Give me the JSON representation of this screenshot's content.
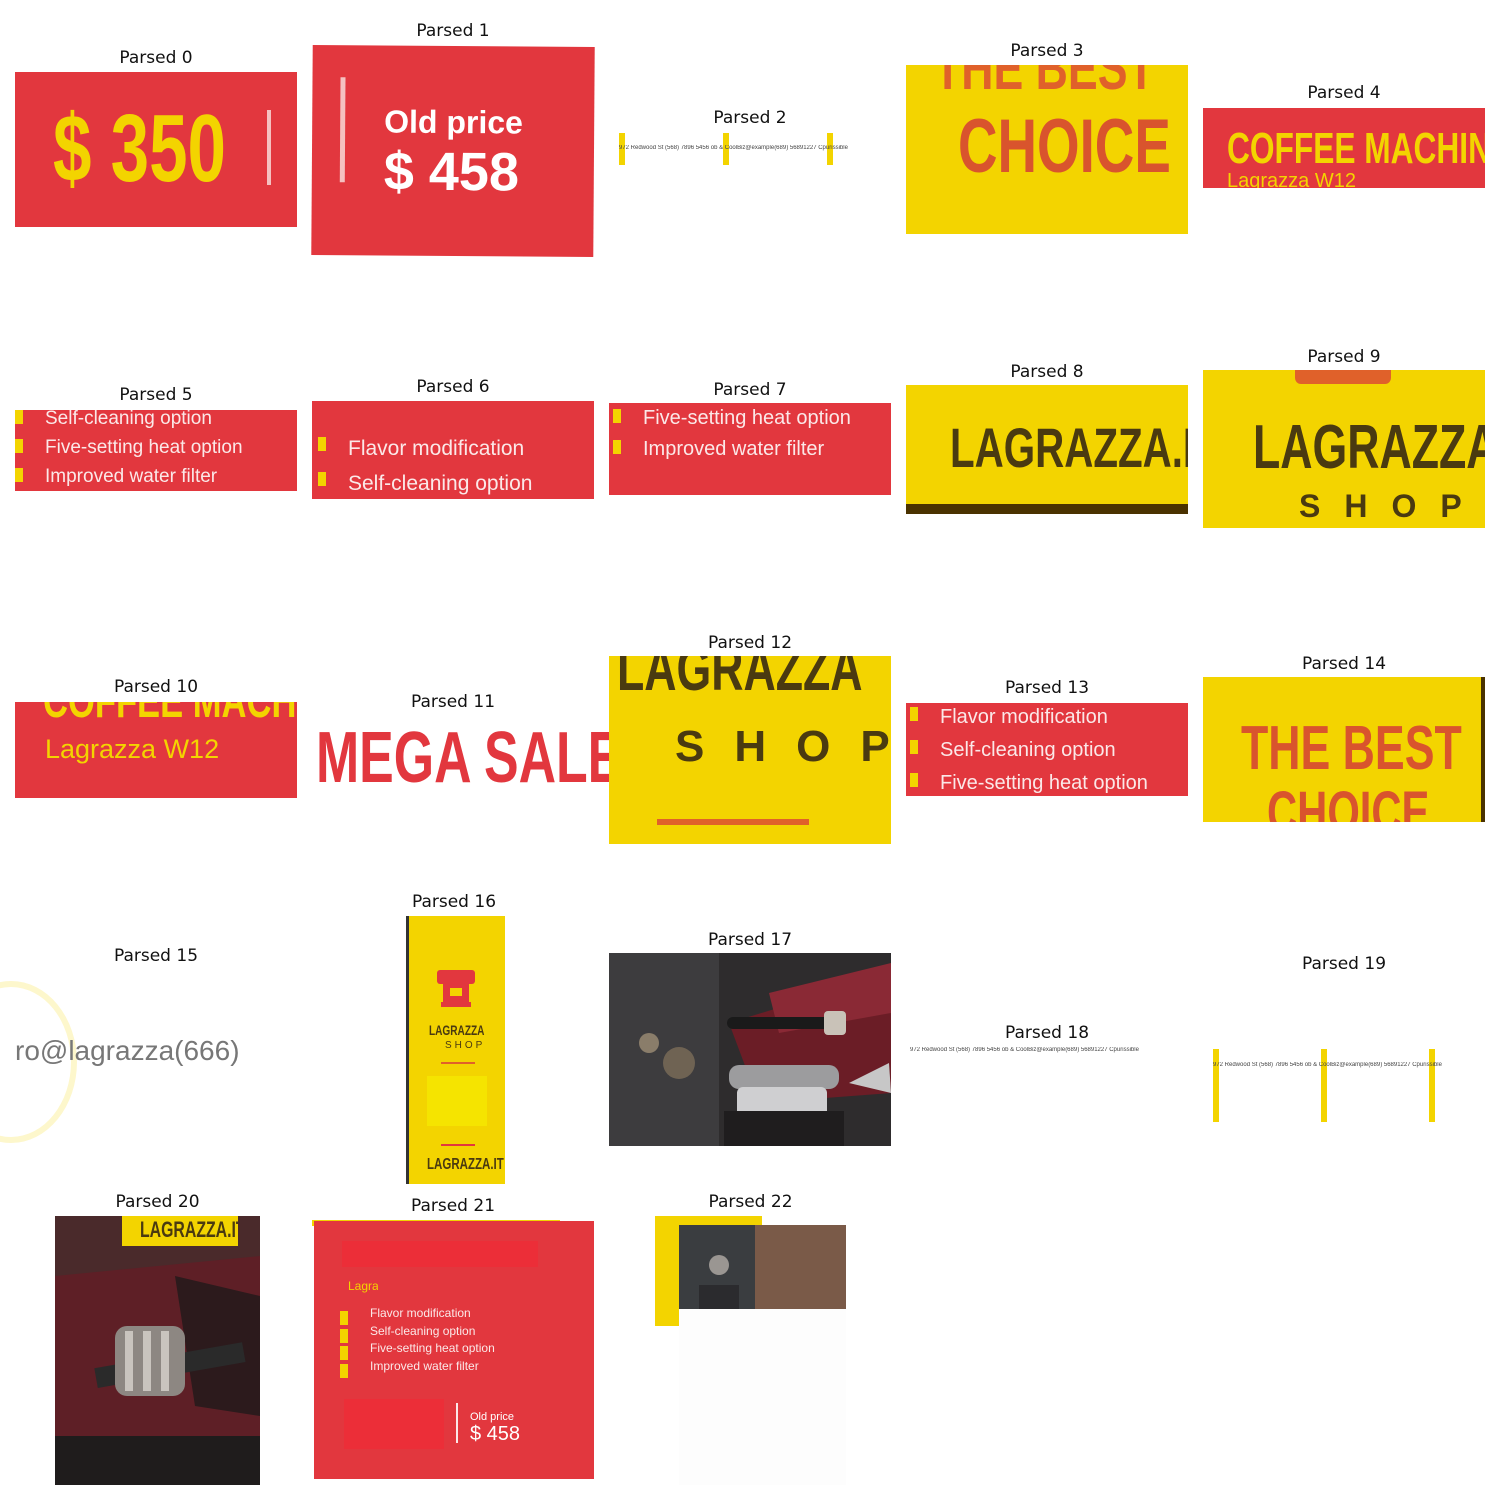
{
  "captions": [
    "Parsed 0",
    "Parsed 1",
    "Parsed 2",
    "Parsed 3",
    "Parsed 4",
    "Parsed 5",
    "Parsed 6",
    "Parsed 7",
    "Parsed 8",
    "Parsed 9",
    "Parsed 10",
    "Parsed 11",
    "Parsed 12",
    "Parsed 13",
    "Parsed 14",
    "Parsed 15",
    "Parsed 16",
    "Parsed 17",
    "Parsed 18",
    "Parsed 19",
    "Parsed 20",
    "Parsed 21",
    "Parsed 22"
  ],
  "colors": {
    "red": "#e2373e",
    "yellow": "#f3d400",
    "dark": "#4a3200"
  },
  "promo": {
    "price": "$ 350",
    "old_price_label": "Old price",
    "old_price": "$ 458",
    "headline": "THE BEST",
    "headline2": "CHOICE",
    "product": "COFFEE MACHINES",
    "model": "Lagrazza W12",
    "sale": "MEGA SALES",
    "brand": "LAGRAZZA",
    "brand_site": "LAGRAZZA.IT",
    "brand_sub": "SHOP",
    "features": [
      "Flavor modification",
      "Self-cleaning option",
      "Five-setting heat option",
      "Improved water filter"
    ]
  },
  "contact": {
    "address": "972 Redwood St (568) 7896 5456 ob & CoolBiz@example(689) 56891227 Cpurissible",
    "fragment": "ro@lagrazza(666)"
  }
}
